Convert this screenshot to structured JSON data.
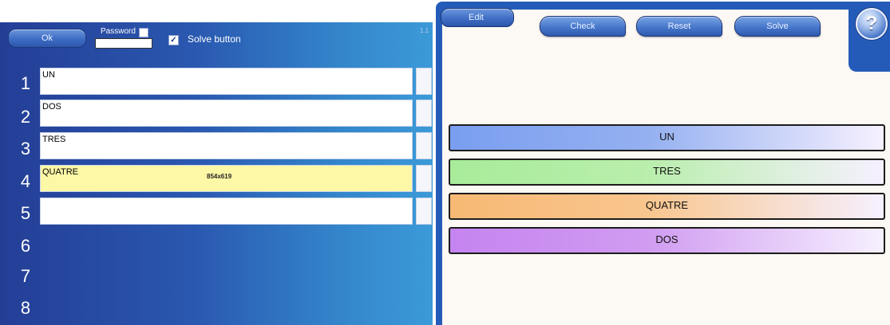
{
  "editor": {
    "ok_label": "Ok",
    "password_label": "Password",
    "password_value": "",
    "solve_button_checked": "✓",
    "solve_button_label": "Solve button",
    "version": "1.1",
    "rows": [
      {
        "number": "1",
        "text": "UN"
      },
      {
        "number": "2",
        "text": "DOS"
      },
      {
        "number": "3",
        "text": "TRES"
      },
      {
        "number": "4",
        "text": "QUATRE"
      },
      {
        "number": "5",
        "text": ""
      },
      {
        "number": "6"
      },
      {
        "number": "7"
      },
      {
        "number": "8"
      }
    ],
    "selection_dims": "854x619"
  },
  "activity": {
    "edit_label": "Edit",
    "check_label": "Check",
    "reset_label": "Reset",
    "solve_label": "Solve",
    "help_label": "?",
    "items": [
      {
        "label": "UN",
        "color": "#7a9ef0"
      },
      {
        "label": "TRES",
        "color": "#a8ec9a"
      },
      {
        "label": "QUATRE",
        "color": "#f7b974"
      },
      {
        "label": "DOS",
        "color": "#c584f0"
      }
    ]
  }
}
